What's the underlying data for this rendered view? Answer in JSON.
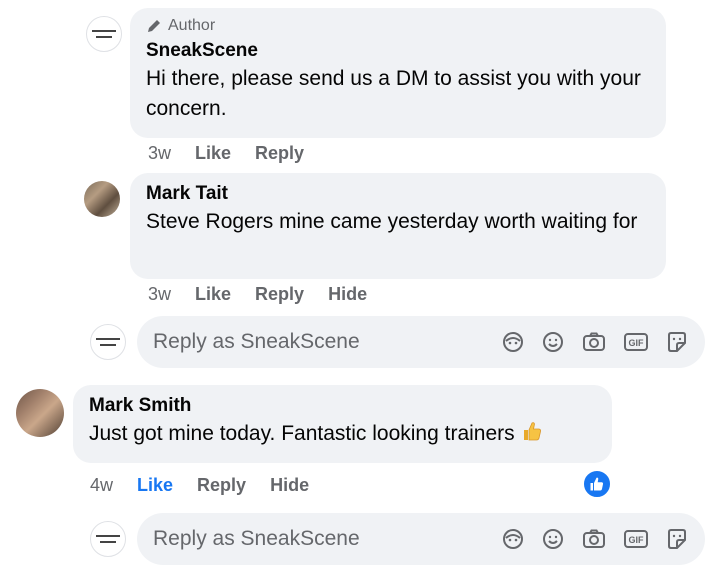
{
  "comments": [
    {
      "author_badge": "Author",
      "name": "SneakScene",
      "text": "Hi there, please send us a DM to assist you with your concern.",
      "actions": {
        "time": "3w",
        "like": "Like",
        "reply": "Reply"
      }
    },
    {
      "name": "Mark Tait",
      "text": "Steve Rogers mine came yesterday worth waiting for",
      "actions": {
        "time": "3w",
        "like": "Like",
        "reply": "Reply",
        "hide": "Hide"
      }
    },
    {
      "name": "Mark Smith",
      "text": "Just got mine today. Fantastic looking trainers",
      "emoji": "thumbs-up",
      "actions": {
        "time": "4w",
        "like": "Like",
        "reply": "Reply",
        "hide": "Hide",
        "liked": true
      }
    }
  ],
  "reply_boxes": [
    {
      "placeholder": "Reply as SneakScene"
    },
    {
      "placeholder": "Reply as SneakScene"
    }
  ],
  "tool_icons": [
    "avatar-sticker-icon",
    "emoji-icon",
    "camera-icon",
    "gif-icon",
    "sticker-icon"
  ],
  "colors": {
    "bubble": "#f0f2f5",
    "secondary_text": "#65676b",
    "like_blue": "#1877f2"
  }
}
